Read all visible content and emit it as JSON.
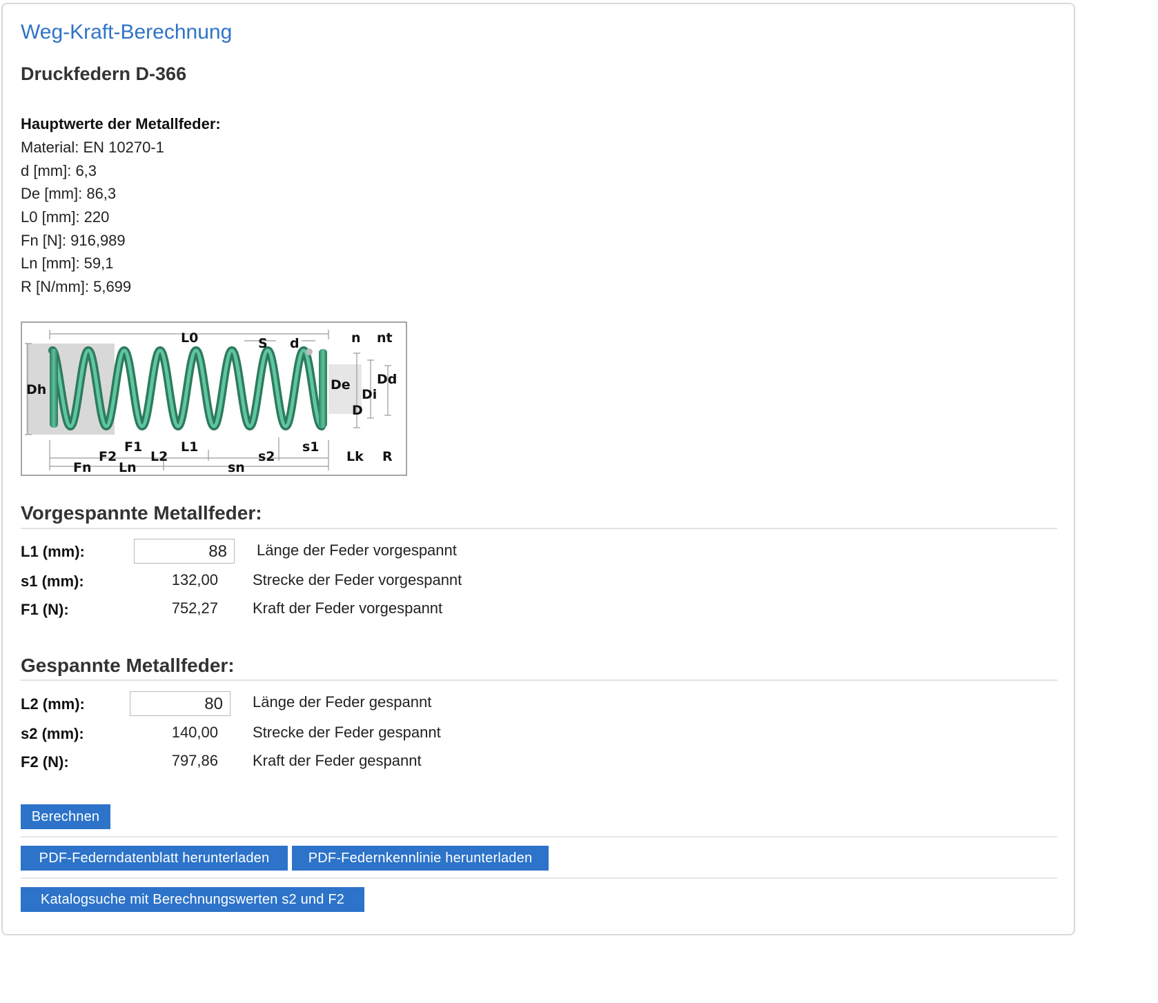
{
  "page": {
    "title": "Weg-Kraft-Berechnung",
    "subtitle": "Druckfedern D-366"
  },
  "main_values": {
    "heading": "Hauptwerte der Metallfeder:",
    "lines": [
      "Material: EN 10270-1",
      "d [mm]: 6,3",
      "De [mm]: 86,3",
      "L0 [mm]: 220",
      "Fn [N]: 916,989",
      "Ln [mm]: 59,1",
      "R [N/mm]: 5,699"
    ]
  },
  "diagram": {
    "labels": {
      "L0": "L0",
      "S": "S",
      "d": "d",
      "n": "n",
      "nt": "nt",
      "Dh": "Dh",
      "De": "De",
      "Di": "Di",
      "Dd": "Dd",
      "D": "D",
      "F1": "F1",
      "F2": "F2",
      "L1": "L1",
      "L2": "L2",
      "s1": "s1",
      "s2": "s2",
      "sn": "sn",
      "Fn": "Fn",
      "Ln": "Ln",
      "Lk": "Lk",
      "R": "R"
    },
    "spring_color": "#3f9f7c"
  },
  "preloaded": {
    "heading": "Vorgespannte Metallfeder:",
    "rows": [
      {
        "label": "L1 (mm):",
        "input_value": "88",
        "desc": "Länge der Feder vorgespannt"
      },
      {
        "label": "s1 (mm):",
        "value": "132,00",
        "desc": "Strecke der Feder vorgespannt"
      },
      {
        "label": "F1 (N):",
        "value": "752,27",
        "desc": "Kraft der Feder vorgespannt"
      }
    ]
  },
  "tensioned": {
    "heading": "Gespannte Metallfeder:",
    "rows": [
      {
        "label": "L2 (mm):",
        "input_value": "80",
        "desc": "Länge der Feder gespannt"
      },
      {
        "label": "s2 (mm):",
        "value": "140,00",
        "desc": "Strecke der Feder gespannt"
      },
      {
        "label": "F2 (N):",
        "value": "797,86",
        "desc": "Kraft der Feder gespannt"
      }
    ]
  },
  "buttons": {
    "calculate": "Berechnen",
    "pdf_datasheet": "PDF-Federndatenblatt herunterladen",
    "pdf_curve": "PDF-Federnkennlinie herunterladen",
    "catalog_search": "Katalogsuche mit Berechnungswerten s2 und F2"
  },
  "colors": {
    "accent": "#2c73c9",
    "title": "#2f73c7",
    "spring": "#3f9f7c"
  }
}
